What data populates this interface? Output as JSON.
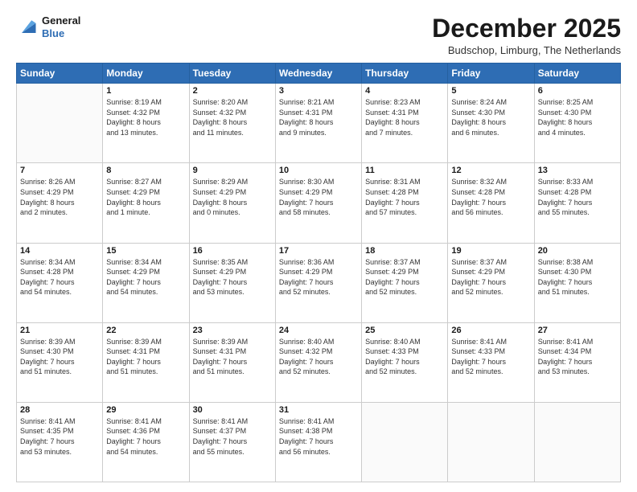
{
  "logo": {
    "line1": "General",
    "line2": "Blue"
  },
  "title": "December 2025",
  "subtitle": "Budschop, Limburg, The Netherlands",
  "days_header": [
    "Sunday",
    "Monday",
    "Tuesday",
    "Wednesday",
    "Thursday",
    "Friday",
    "Saturday"
  ],
  "weeks": [
    [
      {
        "day": "",
        "info": ""
      },
      {
        "day": "1",
        "info": "Sunrise: 8:19 AM\nSunset: 4:32 PM\nDaylight: 8 hours\nand 13 minutes."
      },
      {
        "day": "2",
        "info": "Sunrise: 8:20 AM\nSunset: 4:32 PM\nDaylight: 8 hours\nand 11 minutes."
      },
      {
        "day": "3",
        "info": "Sunrise: 8:21 AM\nSunset: 4:31 PM\nDaylight: 8 hours\nand 9 minutes."
      },
      {
        "day": "4",
        "info": "Sunrise: 8:23 AM\nSunset: 4:31 PM\nDaylight: 8 hours\nand 7 minutes."
      },
      {
        "day": "5",
        "info": "Sunrise: 8:24 AM\nSunset: 4:30 PM\nDaylight: 8 hours\nand 6 minutes."
      },
      {
        "day": "6",
        "info": "Sunrise: 8:25 AM\nSunset: 4:30 PM\nDaylight: 8 hours\nand 4 minutes."
      }
    ],
    [
      {
        "day": "7",
        "info": "Sunrise: 8:26 AM\nSunset: 4:29 PM\nDaylight: 8 hours\nand 2 minutes."
      },
      {
        "day": "8",
        "info": "Sunrise: 8:27 AM\nSunset: 4:29 PM\nDaylight: 8 hours\nand 1 minute."
      },
      {
        "day": "9",
        "info": "Sunrise: 8:29 AM\nSunset: 4:29 PM\nDaylight: 8 hours\nand 0 minutes."
      },
      {
        "day": "10",
        "info": "Sunrise: 8:30 AM\nSunset: 4:29 PM\nDaylight: 7 hours\nand 58 minutes."
      },
      {
        "day": "11",
        "info": "Sunrise: 8:31 AM\nSunset: 4:28 PM\nDaylight: 7 hours\nand 57 minutes."
      },
      {
        "day": "12",
        "info": "Sunrise: 8:32 AM\nSunset: 4:28 PM\nDaylight: 7 hours\nand 56 minutes."
      },
      {
        "day": "13",
        "info": "Sunrise: 8:33 AM\nSunset: 4:28 PM\nDaylight: 7 hours\nand 55 minutes."
      }
    ],
    [
      {
        "day": "14",
        "info": "Sunrise: 8:34 AM\nSunset: 4:28 PM\nDaylight: 7 hours\nand 54 minutes."
      },
      {
        "day": "15",
        "info": "Sunrise: 8:34 AM\nSunset: 4:29 PM\nDaylight: 7 hours\nand 54 minutes."
      },
      {
        "day": "16",
        "info": "Sunrise: 8:35 AM\nSunset: 4:29 PM\nDaylight: 7 hours\nand 53 minutes."
      },
      {
        "day": "17",
        "info": "Sunrise: 8:36 AM\nSunset: 4:29 PM\nDaylight: 7 hours\nand 52 minutes."
      },
      {
        "day": "18",
        "info": "Sunrise: 8:37 AM\nSunset: 4:29 PM\nDaylight: 7 hours\nand 52 minutes."
      },
      {
        "day": "19",
        "info": "Sunrise: 8:37 AM\nSunset: 4:29 PM\nDaylight: 7 hours\nand 52 minutes."
      },
      {
        "day": "20",
        "info": "Sunrise: 8:38 AM\nSunset: 4:30 PM\nDaylight: 7 hours\nand 51 minutes."
      }
    ],
    [
      {
        "day": "21",
        "info": "Sunrise: 8:39 AM\nSunset: 4:30 PM\nDaylight: 7 hours\nand 51 minutes."
      },
      {
        "day": "22",
        "info": "Sunrise: 8:39 AM\nSunset: 4:31 PM\nDaylight: 7 hours\nand 51 minutes."
      },
      {
        "day": "23",
        "info": "Sunrise: 8:39 AM\nSunset: 4:31 PM\nDaylight: 7 hours\nand 51 minutes."
      },
      {
        "day": "24",
        "info": "Sunrise: 8:40 AM\nSunset: 4:32 PM\nDaylight: 7 hours\nand 52 minutes."
      },
      {
        "day": "25",
        "info": "Sunrise: 8:40 AM\nSunset: 4:33 PM\nDaylight: 7 hours\nand 52 minutes."
      },
      {
        "day": "26",
        "info": "Sunrise: 8:41 AM\nSunset: 4:33 PM\nDaylight: 7 hours\nand 52 minutes."
      },
      {
        "day": "27",
        "info": "Sunrise: 8:41 AM\nSunset: 4:34 PM\nDaylight: 7 hours\nand 53 minutes."
      }
    ],
    [
      {
        "day": "28",
        "info": "Sunrise: 8:41 AM\nSunset: 4:35 PM\nDaylight: 7 hours\nand 53 minutes."
      },
      {
        "day": "29",
        "info": "Sunrise: 8:41 AM\nSunset: 4:36 PM\nDaylight: 7 hours\nand 54 minutes."
      },
      {
        "day": "30",
        "info": "Sunrise: 8:41 AM\nSunset: 4:37 PM\nDaylight: 7 hours\nand 55 minutes."
      },
      {
        "day": "31",
        "info": "Sunrise: 8:41 AM\nSunset: 4:38 PM\nDaylight: 7 hours\nand 56 minutes."
      },
      {
        "day": "",
        "info": ""
      },
      {
        "day": "",
        "info": ""
      },
      {
        "day": "",
        "info": ""
      }
    ]
  ]
}
